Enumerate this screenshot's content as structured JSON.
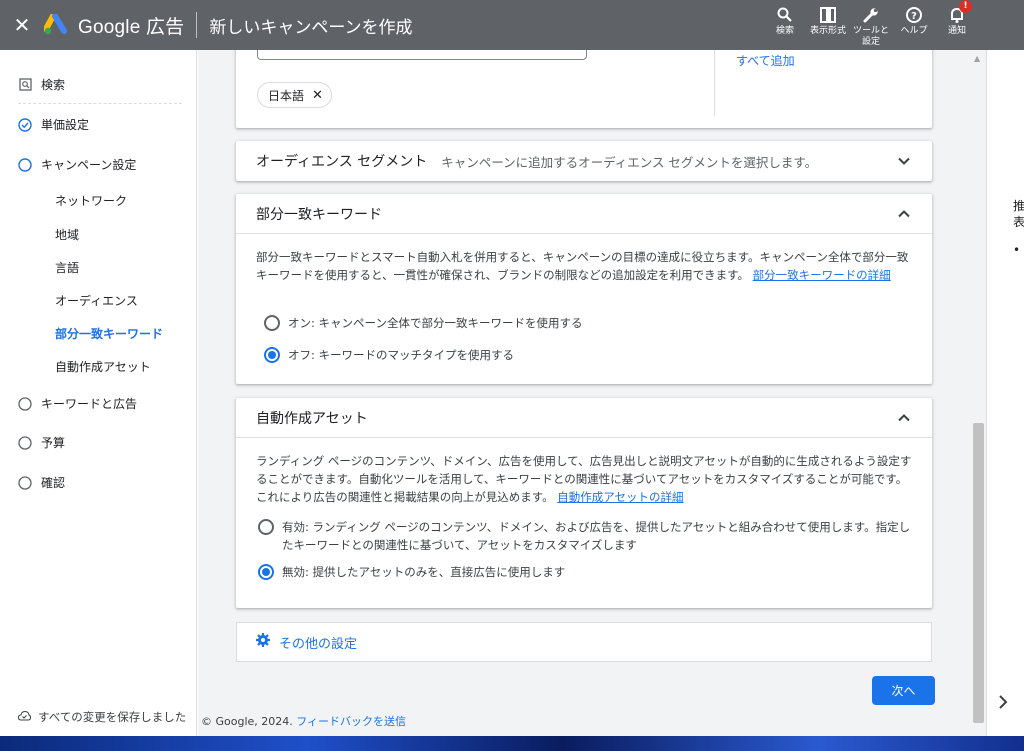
{
  "header": {
    "close_icon": "close-icon",
    "product": "Google 広告",
    "title": "新しいキャンペーンを作成",
    "tools": [
      {
        "icon": "search-icon",
        "label": "検索"
      },
      {
        "icon": "view-icon",
        "label": "表示形式"
      },
      {
        "icon": "wrench-icon",
        "label": "ツールと\n設定"
      },
      {
        "icon": "help-icon",
        "label": "ヘルプ"
      },
      {
        "icon": "bell-icon",
        "label": "通知",
        "badge": "!"
      }
    ]
  },
  "sidebar": {
    "items": [
      {
        "label": "検索",
        "icon": "search-box-icon"
      },
      {
        "label": "単価設定",
        "icon": "check-circle-icon"
      },
      {
        "label": "キャンペーン設定",
        "icon": "circle-outline-icon"
      }
    ],
    "subitems": [
      "ネットワーク",
      "地域",
      "言語",
      "オーディエンス",
      "部分一致キーワード",
      "自動作成アセット"
    ],
    "later_items": [
      "キーワードと広告",
      "予算",
      "確認"
    ],
    "saved": "すべての変更を保存しました"
  },
  "language_card": {
    "chip": "日本語",
    "add_all": "すべて追加"
  },
  "audience": {
    "title": "オーディエンス セグメント",
    "subtitle": "キャンペーンに追加するオーディエンス セグメントを選択します。"
  },
  "broad_match": {
    "title": "部分一致キーワード",
    "description": "部分一致キーワードとスマート自動入札を併用すると、キャンペーンの目標の達成に役立ちます。キャンペーン全体で部分一致キーワードを使用すると、一貫性が確保され、ブランドの制限などの追加設定を利用できます。",
    "link": "部分一致キーワードの詳細",
    "options": [
      {
        "label": "オン: キャンペーン全体で部分一致キーワードを使用する",
        "selected": false
      },
      {
        "label": "オフ: キーワードのマッチタイプを使用する",
        "selected": true
      }
    ]
  },
  "auto_assets": {
    "title": "自動作成アセット",
    "description": "ランディング ページのコンテンツ、ドメイン、広告を使用して、広告見出しと説明文アセットが自動的に生成されるよう設定することができます。自動化ツールを活用して、キーワードとの関連性に基づいてアセットをカスタマイズすることが可能です。これにより広告の関連性と掲載結果の向上が見込めます。",
    "link": "自動作成アセットの詳細",
    "options": [
      {
        "label": "有効: ランディング ページのコンテンツ、ドメイン、および広告を、提供したアセットと組み合わせて使用します。指定したキーワードとの関連性に基づいて、アセットをカスタマイズします",
        "selected": false
      },
      {
        "label": "無効: 提供したアセットのみを、直接広告に使用します",
        "selected": true
      }
    ]
  },
  "more_settings": "その他の設定",
  "next_button": "次へ",
  "footer": {
    "copyright": "© Google, 2024.",
    "feedback": "フィードバックを送信"
  },
  "right_panel": {
    "line1": "推",
    "line2": "表",
    "bullet": "•"
  },
  "colors": {
    "topbar": "#5f6368",
    "accent": "#1a73e8",
    "main_bg": "#f1f3f4"
  }
}
